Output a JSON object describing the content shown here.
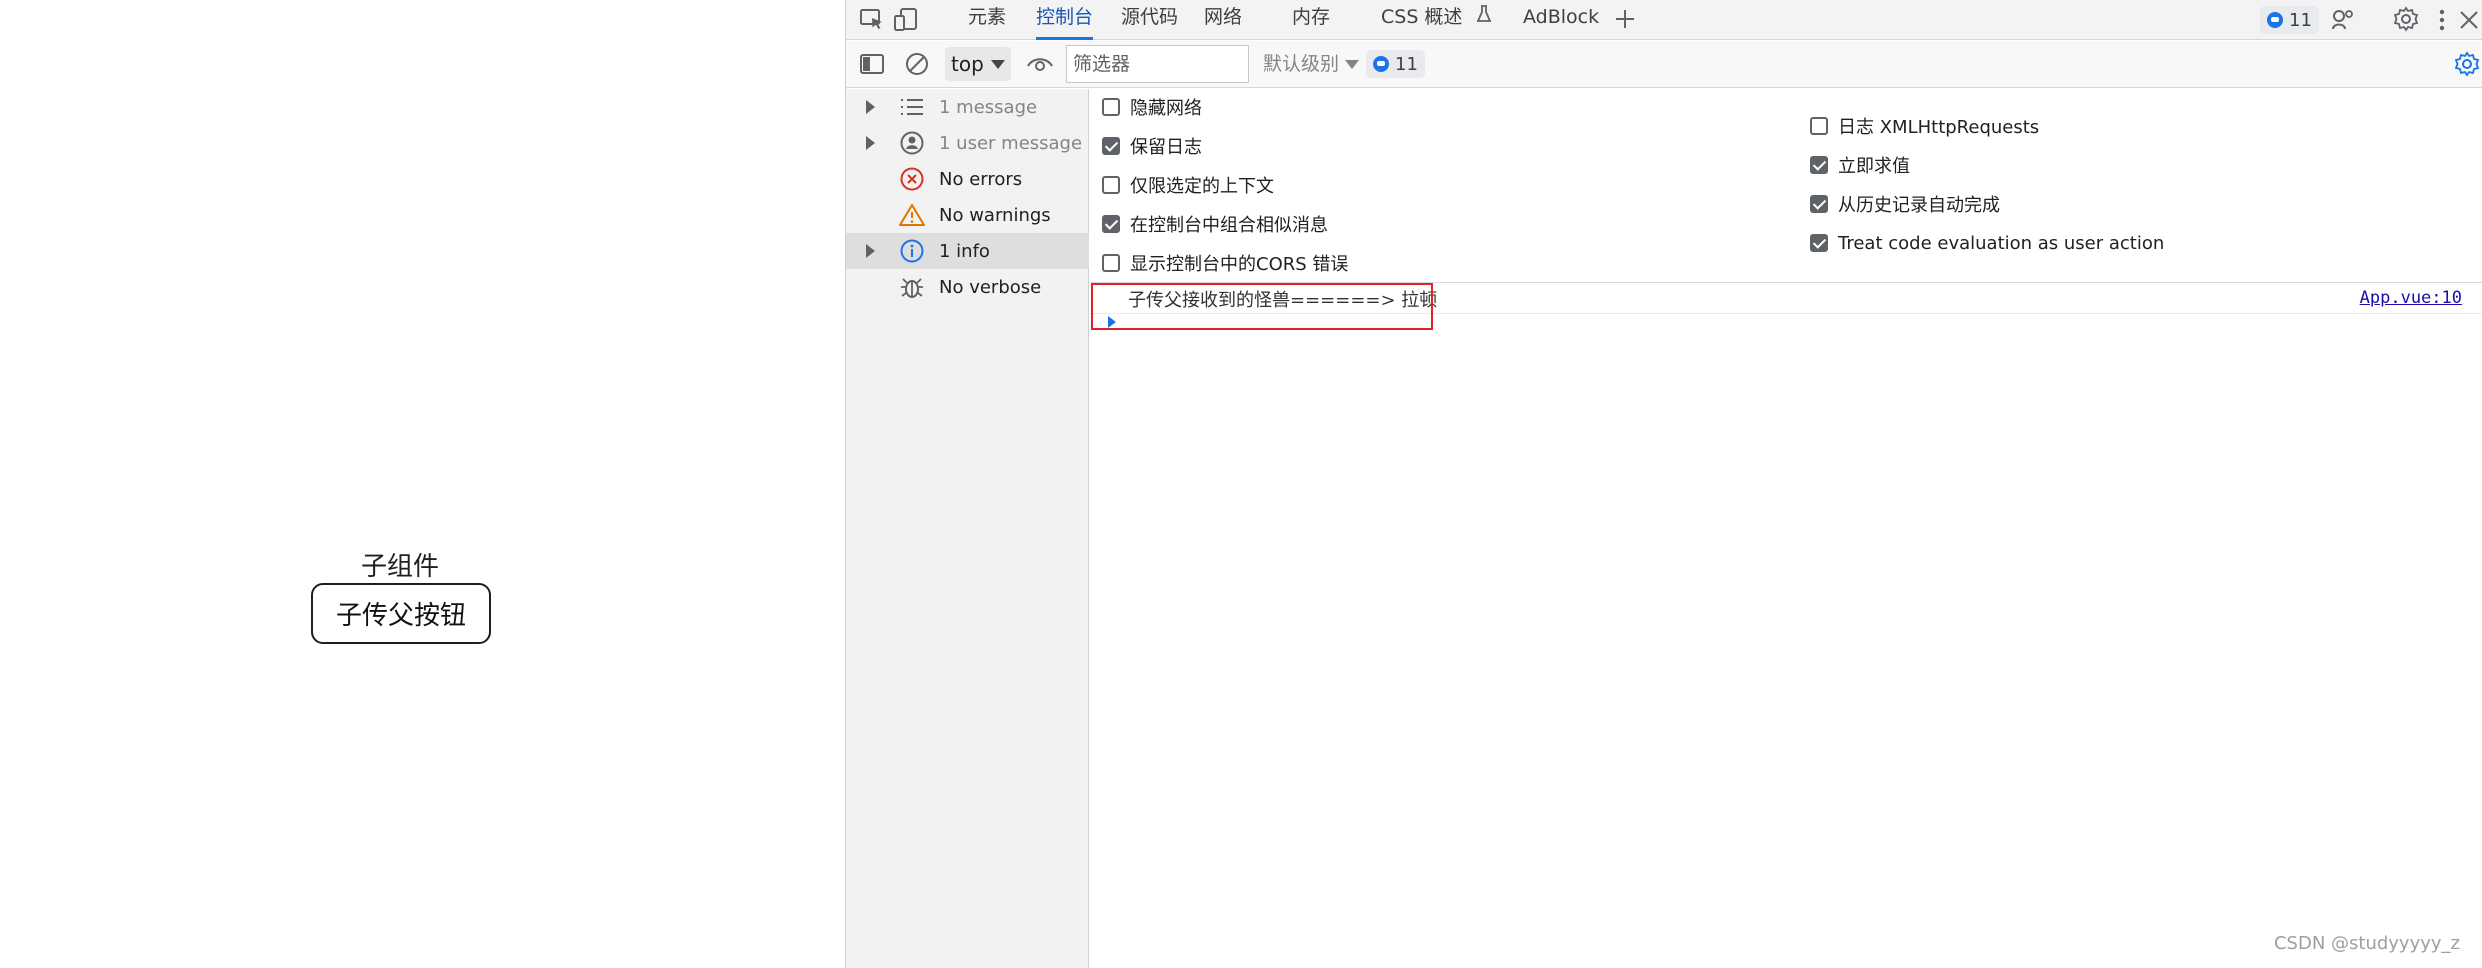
{
  "app": {
    "component_title": "子组件",
    "button_label": "子传父按钮"
  },
  "devtools": {
    "tabs": [
      {
        "label": "元素",
        "active": false
      },
      {
        "label": "控制台",
        "active": true
      },
      {
        "label": "源代码",
        "active": false
      },
      {
        "label": "网络",
        "active": false
      },
      {
        "label": "内存",
        "active": false
      },
      {
        "label": "CSS 概述",
        "active": false
      },
      {
        "label": "AdBlock",
        "active": false
      }
    ],
    "issues_badge_count": "11",
    "toolbar": {
      "context": "top",
      "filter_placeholder": "筛选器",
      "level": "默认级别",
      "issues_count": "11"
    },
    "sidebar": [
      {
        "label": "1 message",
        "icon": "list-icon",
        "expandable": true
      },
      {
        "label": "1 user message",
        "icon": "user-icon",
        "expandable": true
      },
      {
        "label": "No errors",
        "icon": "error-icon",
        "expandable": false
      },
      {
        "label": "No warnings",
        "icon": "warning-icon",
        "expandable": false
      },
      {
        "label": "1 info",
        "icon": "info-icon",
        "expandable": true,
        "selected": true
      },
      {
        "label": "No verbose",
        "icon": "bug-icon",
        "expandable": false
      }
    ],
    "settings_left": [
      {
        "label": "隐藏网络",
        "checked": false
      },
      {
        "label": "保留日志",
        "checked": true
      },
      {
        "label": "仅限选定的上下文",
        "checked": false
      },
      {
        "label": "在控制台中组合相似消息",
        "checked": true
      },
      {
        "label": "显示控制台中的CORS 错误",
        "checked": false
      }
    ],
    "settings_right": [
      {
        "label": "日志 XMLHttpRequests",
        "checked": false
      },
      {
        "label": "立即求值",
        "checked": true
      },
      {
        "label": "从历史记录自动完成",
        "checked": true
      },
      {
        "label": "Treat code evaluation as user action",
        "checked": true
      }
    ],
    "log": {
      "message": "子传父接收到的怪兽======> 拉顿",
      "source": "App.vue:10"
    }
  },
  "watermark": "CSDN @studyyyyy_z",
  "colors": {
    "accent": "#1a73e8",
    "highlight": "#e0232b",
    "error": "#d93025",
    "warning": "#e37400"
  }
}
